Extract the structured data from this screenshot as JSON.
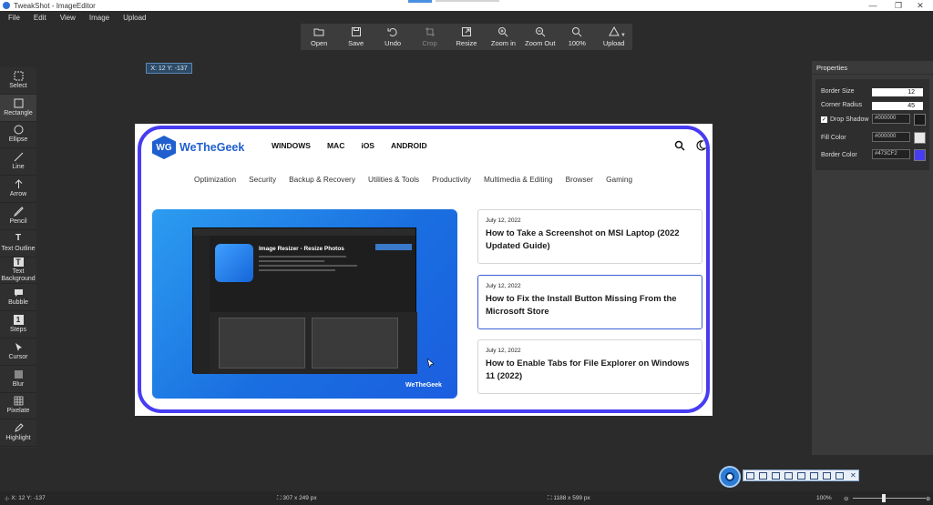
{
  "window": {
    "title": "TweakShot - ImageEditor"
  },
  "menu": [
    "File",
    "Edit",
    "View",
    "Image",
    "Upload"
  ],
  "toolbar": [
    {
      "label": "Open",
      "icon": "folder-open-icon",
      "enabled": true
    },
    {
      "label": "Save",
      "icon": "save-icon",
      "enabled": true
    },
    {
      "label": "Undo",
      "icon": "undo-icon",
      "enabled": true
    },
    {
      "label": "Crop",
      "icon": "crop-icon",
      "enabled": false
    },
    {
      "label": "Resize",
      "icon": "resize-icon",
      "enabled": true
    },
    {
      "label": "Zoom in",
      "icon": "zoom-in-icon",
      "enabled": true
    },
    {
      "label": "Zoom Out",
      "icon": "zoom-out-icon",
      "enabled": true
    },
    {
      "label": "100%",
      "icon": "zoom-reset-icon",
      "enabled": true
    },
    {
      "label": "Upload",
      "icon": "upload-icon",
      "enabled": true
    }
  ],
  "tools": [
    {
      "label": "Select",
      "icon": "select-icon"
    },
    {
      "label": "Rectangle",
      "icon": "rectangle-icon"
    },
    {
      "label": "Ellipse",
      "icon": "ellipse-icon"
    },
    {
      "label": "Line",
      "icon": "line-icon"
    },
    {
      "label": "Arrow",
      "icon": "arrow-icon"
    },
    {
      "label": "Pencil",
      "icon": "pencil-icon"
    },
    {
      "label": "Text Outline",
      "icon": "text-outline-icon"
    },
    {
      "label": "Text Background",
      "icon": "text-background-icon"
    },
    {
      "label": "Bubble",
      "icon": "bubble-icon"
    },
    {
      "label": "Steps",
      "icon": "steps-icon"
    },
    {
      "label": "Cursor",
      "icon": "cursor-icon"
    },
    {
      "label": "Blur",
      "icon": "blur-icon"
    },
    {
      "label": "Pixelate",
      "icon": "pixelate-icon"
    },
    {
      "label": "Highlight",
      "icon": "highlight-icon"
    }
  ],
  "coord_badge": "X: 12 Y: -137",
  "site": {
    "brand": "WeTheGeek",
    "top_nav": [
      "WINDOWS",
      "MAC",
      "iOS",
      "ANDROID"
    ],
    "categories": [
      "Optimization",
      "Security",
      "Backup & Recovery",
      "Utilities & Tools",
      "Productivity",
      "Multimedia & Editing",
      "Browser",
      "Gaming"
    ],
    "hero_brand": "WeTheGeek",
    "hero_app_title": "Image Resizer - Resize Photos",
    "articles": [
      {
        "date": "July 12, 2022",
        "title": "How to Take a Screenshot on MSI Laptop (2022 Updated Guide)"
      },
      {
        "date": "July 12, 2022",
        "title": "How to Fix the Install Button Missing From the Microsoft Store"
      },
      {
        "date": "July 12, 2022",
        "title": "How to Enable Tabs for File Explorer on Windows 11 (2022)"
      }
    ]
  },
  "properties": {
    "title": "Properties",
    "border_size_label": "Border Size",
    "border_size": "12",
    "corner_radius_label": "Corner Radius",
    "corner_radius": "45",
    "drop_shadow_label": "Drop Shadow",
    "drop_shadow_checked": true,
    "drop_shadow_color": "#000000",
    "fill_color_label": "Fill Color",
    "fill_color": "#000000",
    "border_color_label": "Border Color",
    "border_color": "#473CF2"
  },
  "status": {
    "coords": "X: 12 Y: -137",
    "selection_size": "307 x 249 px",
    "image_size": "1188 x 599 px",
    "zoom": "100%"
  },
  "colors": {
    "accent": "#473CF2",
    "site_blue": "#1f5fcf"
  }
}
